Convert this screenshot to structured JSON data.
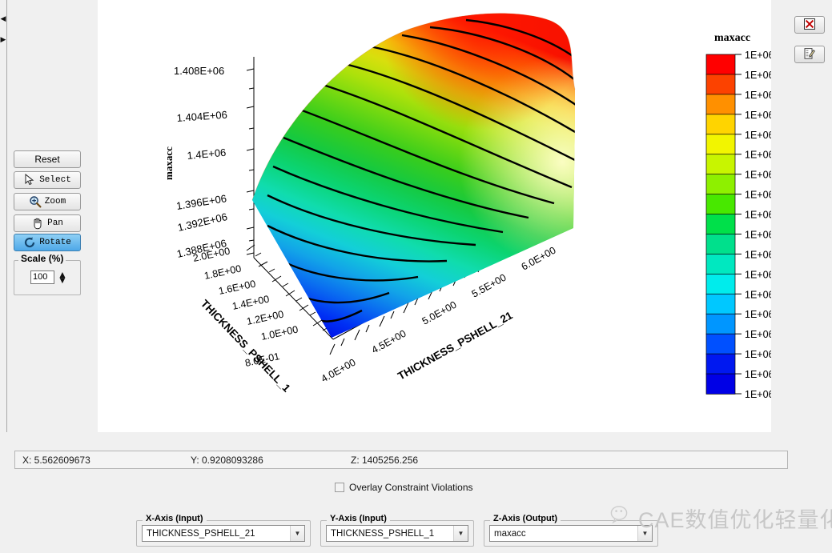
{
  "tools": {
    "buttons": [
      {
        "label": "Reset",
        "icon": "none",
        "active": false
      },
      {
        "label": "Select",
        "icon": "cursor-arrow-icon",
        "active": false
      },
      {
        "label": "Zoom",
        "icon": "magnifier-plus-icon",
        "active": false
      },
      {
        "label": "Pan",
        "icon": "hand-icon",
        "active": false
      },
      {
        "label": "Rotate",
        "icon": "rotate-arrow-icon",
        "active": true
      }
    ],
    "scale_group_label": "Scale (%)",
    "scale_value": "100"
  },
  "side_buttons": [
    {
      "name": "delete-plot-button",
      "icon": "red-x-box-icon"
    },
    {
      "name": "edit-plot-button",
      "icon": "edit-pencil-icon"
    }
  ],
  "status": {
    "x": "X: 5.562609673",
    "y": "Y: 0.9208093286",
    "z": "Z: 1405256.256"
  },
  "options": {
    "overlay_checkbox_label": "Overlay Constraint Violations",
    "overlay_checked": false
  },
  "selectors": [
    {
      "title": "X-Axis (Input)",
      "value": "THICKNESS_PSHELL_21"
    },
    {
      "title": "Y-Axis (Input)",
      "value": "THICKNESS_PSHELL_1"
    },
    {
      "title": "Z-Axis (Output)",
      "value": "maxacc"
    }
  ],
  "watermark": {
    "text": "CAE数值优化轻量化",
    "icon": "wechat-icon"
  },
  "colorbar": {
    "title": "maxacc",
    "labels": [
      "1E+06",
      "1E+06",
      "1E+06",
      "1E+06",
      "1E+06",
      "1E+06",
      "1E+06",
      "1E+06",
      "1E+06",
      "1E+06",
      "1E+06",
      "1E+06",
      "1E+06",
      "1E+06",
      "1E+06",
      "1E+06",
      "1E+06"
    ],
    "colors": [
      "#ff0000",
      "#fc4200",
      "#ff9000",
      "#ffd400",
      "#f2f500",
      "#c8f500",
      "#8ef000",
      "#48e800",
      "#00e04a",
      "#00e08c",
      "#00e8c0",
      "#00ecec",
      "#00c8ff",
      "#0096ff",
      "#0050ff",
      "#0018f0",
      "#0000e6"
    ]
  },
  "chart_data": {
    "type": "surface",
    "title": "",
    "xlabel": "THICKNESS_PSHELL_21",
    "ylabel": "THICKNESS_PSHELL_1",
    "zlabel": "maxacc",
    "xticks": [
      "4.0E+00",
      "4.5E+00",
      "5.0E+00",
      "5.5E+00",
      "6.0E+00"
    ],
    "xlim": [
      4.0,
      6.0
    ],
    "yticks": [
      "8.0E-01",
      "1.0E+00",
      "1.2E+00",
      "1.4E+00",
      "1.6E+00",
      "1.8E+00",
      "2.0E+00"
    ],
    "ylim": [
      0.8,
      2.0
    ],
    "zticks": [
      "1.388E+06",
      "1.392E+06",
      "1.396E+06",
      "1.4E+06",
      "1.404E+06",
      "1.408E+06"
    ],
    "zlim": [
      1388000,
      1409000
    ],
    "colormap": "jet",
    "contours": true,
    "grid": false,
    "legend_position": "right",
    "surface_notes": "Response-surface sheet rising from a deep-blue low corner near (x=4.0, y=0.8) to a red high ridge at the far (x small, y large) back edge; 12 black iso-level contour lines run across the sheet."
  }
}
